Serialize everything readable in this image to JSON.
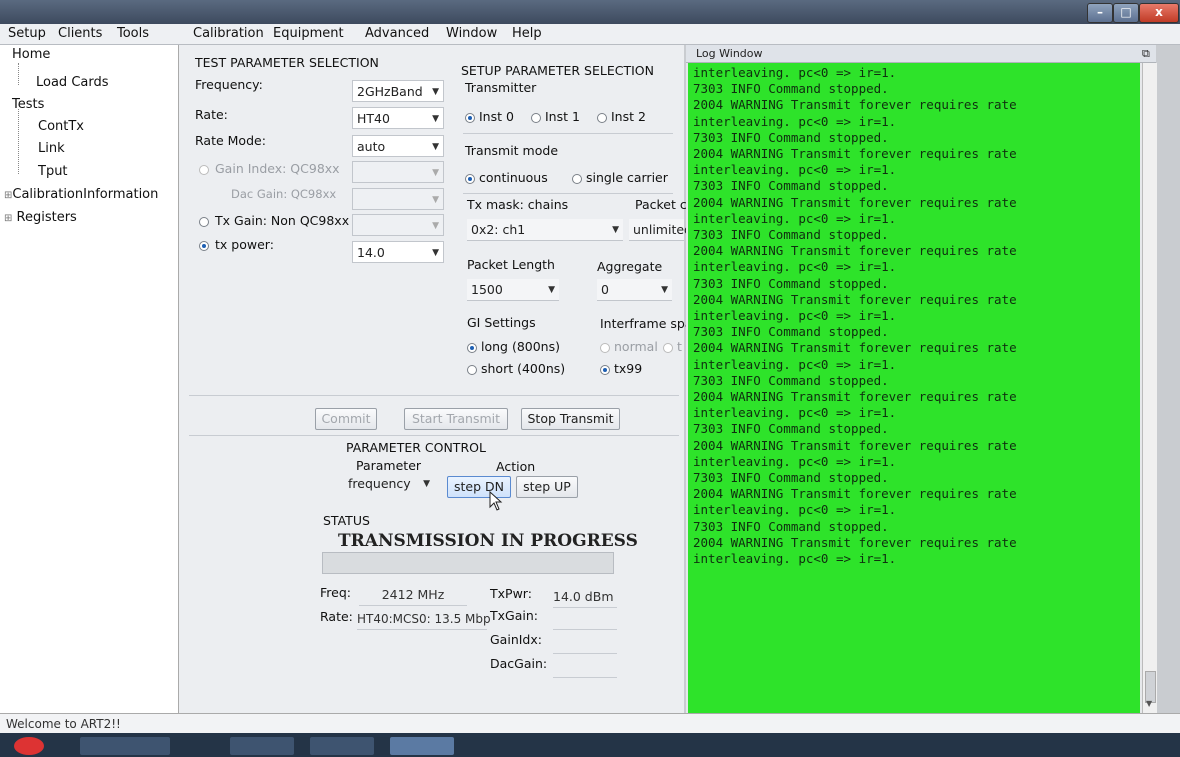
{
  "menubar": [
    "Setup",
    "Clients",
    "Tools",
    "Calibration",
    "Equipment",
    "Advanced",
    "Window",
    "Help"
  ],
  "window_buttons": {
    "minimize": "–",
    "maximize": "□",
    "close": "x"
  },
  "tree": {
    "home": "Home",
    "load_cards": "Load Cards",
    "tests": "Tests",
    "cont_tx": "ContTx",
    "link": "Link",
    "tput": "Tput",
    "calibration_info": "CalibrationInformation",
    "registers": "Registers"
  },
  "test_params": {
    "heading": "TEST PARAMETER SELECTION",
    "frequency_label": "Frequency:",
    "frequency_value": "2GHzBand",
    "rate_label": "Rate:",
    "rate_value": "HT40",
    "rate_mode_label": "Rate Mode:",
    "rate_mode_value": "auto",
    "gain_index_label": "Gain Index: QC98xx",
    "dac_gain_label": "Dac Gain: QC98xx",
    "tx_gain_label": "Tx Gain: Non QC98xx",
    "tx_power_label": "tx power:",
    "tx_power_value": "14.0"
  },
  "setup_params": {
    "heading": "SETUP PARAMETER SELECTION",
    "transmitter_label": "Transmitter",
    "inst0": "Inst 0",
    "inst1": "Inst 1",
    "inst2": "Inst 2",
    "transmit_mode_label": "Transmit mode",
    "continuous": "continuous",
    "single_carrier": "single carrier",
    "tx_mask_label": "Tx mask: chains",
    "tx_mask_value": "0x2: ch1",
    "packet_count_label": "Packet c",
    "packet_count_value": "unlimited",
    "packet_length_label": "Packet Length",
    "packet_length_value": "1500",
    "aggregate_label": "Aggregate",
    "aggregate_value": "0",
    "gi_settings_label": "GI Settings",
    "gi_long": "long (800ns)",
    "gi_short": "short (400ns)",
    "interframe_label": "Interframe spa",
    "if_normal": "normal",
    "if_t": "t",
    "if_tx99": "tx99"
  },
  "actions": {
    "commit": "Commit",
    "start": "Start Transmit",
    "stop": "Stop Transmit"
  },
  "param_control": {
    "heading": "PARAMETER CONTROL",
    "parameter_label": "Parameter",
    "parameter_value": "frequency",
    "action_label": "Action",
    "step_dn": "step DN",
    "step_up": "step UP"
  },
  "status": {
    "label": "STATUS",
    "message": "TRANSMISSION IN PROGRESS",
    "freq_label": "Freq:",
    "freq_value": "2412 MHz",
    "rate_label": "Rate:",
    "rate_value": "HT40:MCS0: 13.5 Mbp",
    "txpwr_label": "TxPwr:",
    "txpwr_value": "14.0 dBm",
    "txgain_label": "TxGain:",
    "gainidx_label": "GainIdx:",
    "dacgain_label": "DacGain:"
  },
  "log": {
    "title": "Log Window",
    "text": "interleaving. pc<0 => ir=1.\n7303 INFO Command stopped.\n2004 WARNING Transmit forever requires rate\ninterleaving. pc<0 => ir=1.\n7303 INFO Command stopped.\n2004 WARNING Transmit forever requires rate\ninterleaving. pc<0 => ir=1.\n7303 INFO Command stopped.\n2004 WARNING Transmit forever requires rate\ninterleaving. pc<0 => ir=1.\n7303 INFO Command stopped.\n2004 WARNING Transmit forever requires rate\ninterleaving. pc<0 => ir=1.\n7303 INFO Command stopped.\n2004 WARNING Transmit forever requires rate\ninterleaving. pc<0 => ir=1.\n7303 INFO Command stopped.\n2004 WARNING Transmit forever requires rate\ninterleaving. pc<0 => ir=1.\n7303 INFO Command stopped.\n2004 WARNING Transmit forever requires rate\ninterleaving. pc<0 => ir=1.\n7303 INFO Command stopped.\n2004 WARNING Transmit forever requires rate\ninterleaving. pc<0 => ir=1.\n7303 INFO Command stopped.\n2004 WARNING Transmit forever requires rate\ninterleaving. pc<0 => ir=1.\n7303 INFO Command stopped.\n2004 WARNING Transmit forever requires rate\ninterleaving. pc<0 => ir=1.",
    "background": "#2ee32a"
  },
  "statusbar": {
    "text": "Welcome to ART2!!"
  }
}
